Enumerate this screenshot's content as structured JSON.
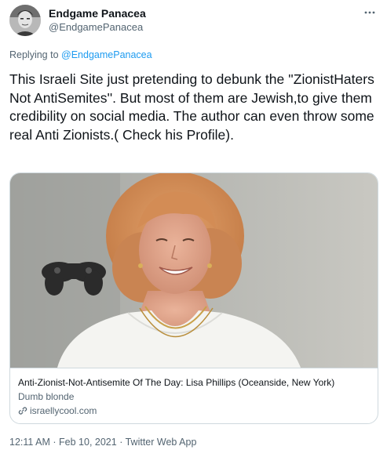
{
  "author": {
    "name": "Endgame Panacea",
    "handle": "@EndgamePanacea",
    "avatar_icon": "profile-avatar"
  },
  "more_icon": "more-horizontal-icon",
  "reply": {
    "prefix": "Replying to",
    "handle": "@EndgamePanacea"
  },
  "tweet": {
    "text": "This Israeli Site just pretending to debunk the ''ZionistHaters Not AntiSemites''. But most of them are Jewish,to give them credibility on social media. The author can even throw some real Anti Zionists.( Check his Profile)."
  },
  "card": {
    "image_icon": "link-preview-photo",
    "title": "Anti-Zionist-Not-Antisemite Of The Day: Lisa Phillips (Oceanside, New York)",
    "description": "Dumb blonde",
    "domain": "israellycool.com",
    "domain_icon": "link-icon"
  },
  "meta": {
    "time": "12:11 AM",
    "separator": "·",
    "date": "Feb 10, 2021",
    "app": "Twitter Web App"
  },
  "colors": {
    "text": "#0f1419",
    "secondary": "#536471",
    "link": "#1d9bf0",
    "border": "#cfd9de"
  }
}
